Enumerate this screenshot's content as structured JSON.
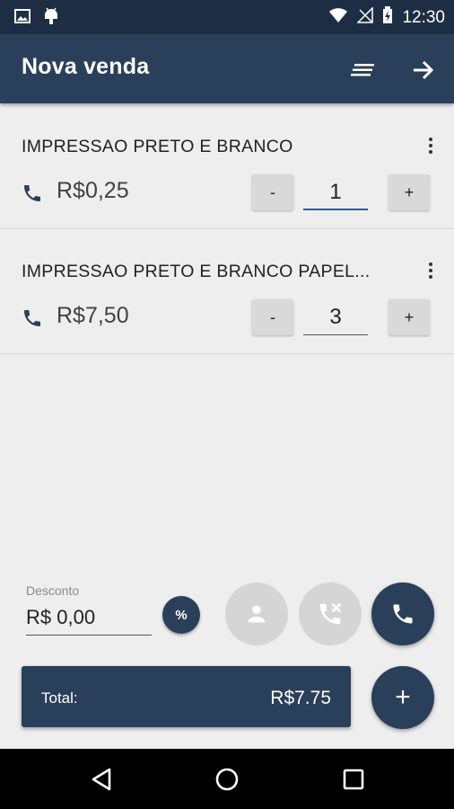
{
  "status_bar": {
    "time": "12:30",
    "icons": [
      "image-icon",
      "android-icon",
      "wifi-icon",
      "no-signal-icon",
      "battery-charging-icon"
    ]
  },
  "app_bar": {
    "title": "Nova venda",
    "actions": [
      "sort-icon",
      "arrow-forward-icon"
    ]
  },
  "items": [
    {
      "name": "IMPRESSAO PRETO E BRANCO",
      "price": "R$0,25",
      "minus": "-",
      "plus": "+",
      "quantity": "1"
    },
    {
      "name": "IMPRESSAO PRETO E BRANCO PAPEL...",
      "price": "R$7,50",
      "minus": "-",
      "plus": "+",
      "quantity": "3"
    }
  ],
  "discount": {
    "label": "Desconto",
    "value": "R$ 0,00",
    "percent_label": "%"
  },
  "actions": [
    "person-icon",
    "phone-off-icon",
    "phone-icon"
  ],
  "total": {
    "label": "Total:",
    "value": "R$7.75"
  },
  "add_label": "+",
  "colors": {
    "primary": "#2a3f5a",
    "status_bar": "#1d2e44",
    "background": "#eeeeee",
    "accent_underline": "#2f5a93"
  }
}
